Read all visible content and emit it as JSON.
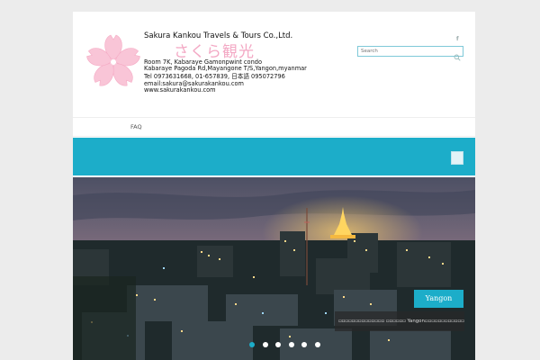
{
  "brand": {
    "title": "Sakura Kankou Travels & Tours Co.,Ltd.",
    "jp_name": "さくら観光",
    "address_lines": [
      "Room 7K, Kabaraye Gamonpwint condo",
      "Kabaraye Pagoda Rd,Mayangone T/S,Yangon,myanmar"
    ],
    "phone": "Tel 0973631668, 01-657839, 日本語 095072796",
    "email": "email:sakura@sakurakankou.com",
    "website": "www.sakurakankou.com"
  },
  "search": {
    "placeholder": "Search"
  },
  "nav": {
    "faq_label": "FAQ"
  },
  "colors": {
    "accent": "#1cadc9",
    "logo_pink": "#f9c5d7",
    "page_bg": "#ececec"
  },
  "icons": [
    "sakura-logo-icon",
    "search-icon",
    "facebook-icon",
    "menu-toggle-icon"
  ],
  "slider": {
    "caption_title": "Yangon",
    "caption_text": "▫▫▫▫▫▫▫▫▫▫▫▫▫▫ ▫▫▫▫▫▫ Yangon▫▫▫▫▫▫▫▫▫▫▫▫▫▫▫▫▫▫▫▫▫▫▫▫▫▫▫▫",
    "slide_count": 6,
    "active_slide": 1
  }
}
